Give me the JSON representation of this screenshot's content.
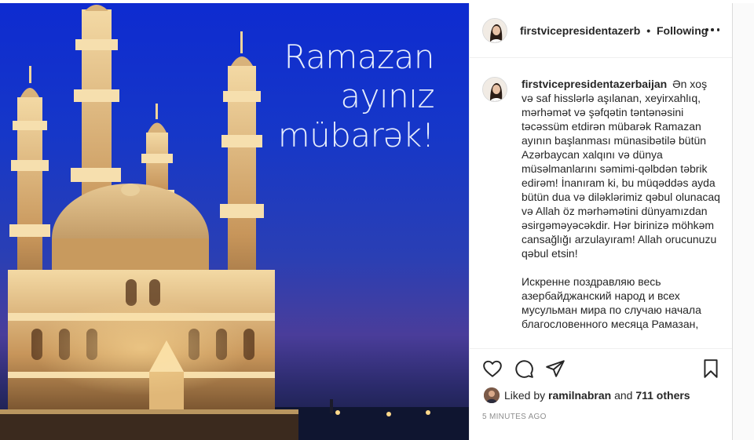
{
  "photo": {
    "caption_lines": [
      "Ramazan",
      "ayınız",
      "mübarək!"
    ]
  },
  "header": {
    "username": "firstvicepresidentazerb",
    "separator": "•",
    "follow_status": "Following",
    "more_icon": "more-horizontal-icon"
  },
  "caption": {
    "username": "firstvicepresidentazerbaijan",
    "text_az": "Ən xoş və saf hisslərlə aşılanan, xeyirxahlıq, mərhəmət və şəfqətin təntənəsini təcəssüm etdirən mübarək Ramazan ayının başlanması münasibətilə bütün Azərbaycan xalqını və dünya müsəlmanlarını səmimi-qəlbdən təbrik edirəm! İnanıram ki, bu müqəddəs ayda bütün dua və diləklərimiz qəbul olunacaq və Allah öz mərhəmətini dünyamızdan əsirgəməyəcəkdir. Hər birinizə möhkəm cansağlığı arzulayıram! Allah orucunuzu qəbul etsin!",
    "text_ru": "Искренне поздравляю весь азербайджанский народ и всех мусульман мира по случаю начала благословенного месяца Рамазан,"
  },
  "actions": {
    "like_icon": "heart-icon",
    "comment_icon": "comment-icon",
    "share_icon": "paper-plane-icon",
    "save_icon": "bookmark-icon"
  },
  "likes": {
    "prefix": "Liked by",
    "user": "ramilnabran",
    "conjunction": "and",
    "others": "711 others"
  },
  "timestamp": "5 MINUTES AGO"
}
